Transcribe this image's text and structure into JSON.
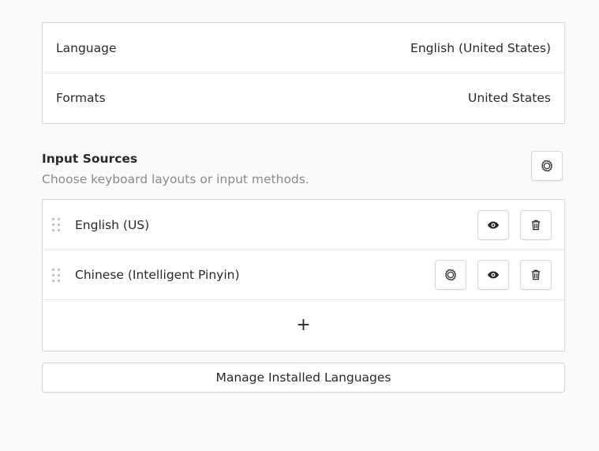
{
  "region": {
    "rows": [
      {
        "label": "Language",
        "value": "English (United States)"
      },
      {
        "label": "Formats",
        "value": "United States"
      }
    ]
  },
  "input_sources": {
    "title": "Input Sources",
    "subtitle": "Choose keyboard layouts or input methods.",
    "options_icon": "gear-icon",
    "items": [
      {
        "name": "English (US)",
        "has_settings": false
      },
      {
        "name": "Chinese (Intelligent Pinyin)",
        "has_settings": true
      }
    ],
    "add_label": "+"
  },
  "manage_button": {
    "label": "Manage Installed Languages"
  },
  "colors": {
    "background": "#fafafa",
    "card": "#ffffff",
    "border": "#d6d6d6",
    "muted_text": "#8a8a8a"
  }
}
